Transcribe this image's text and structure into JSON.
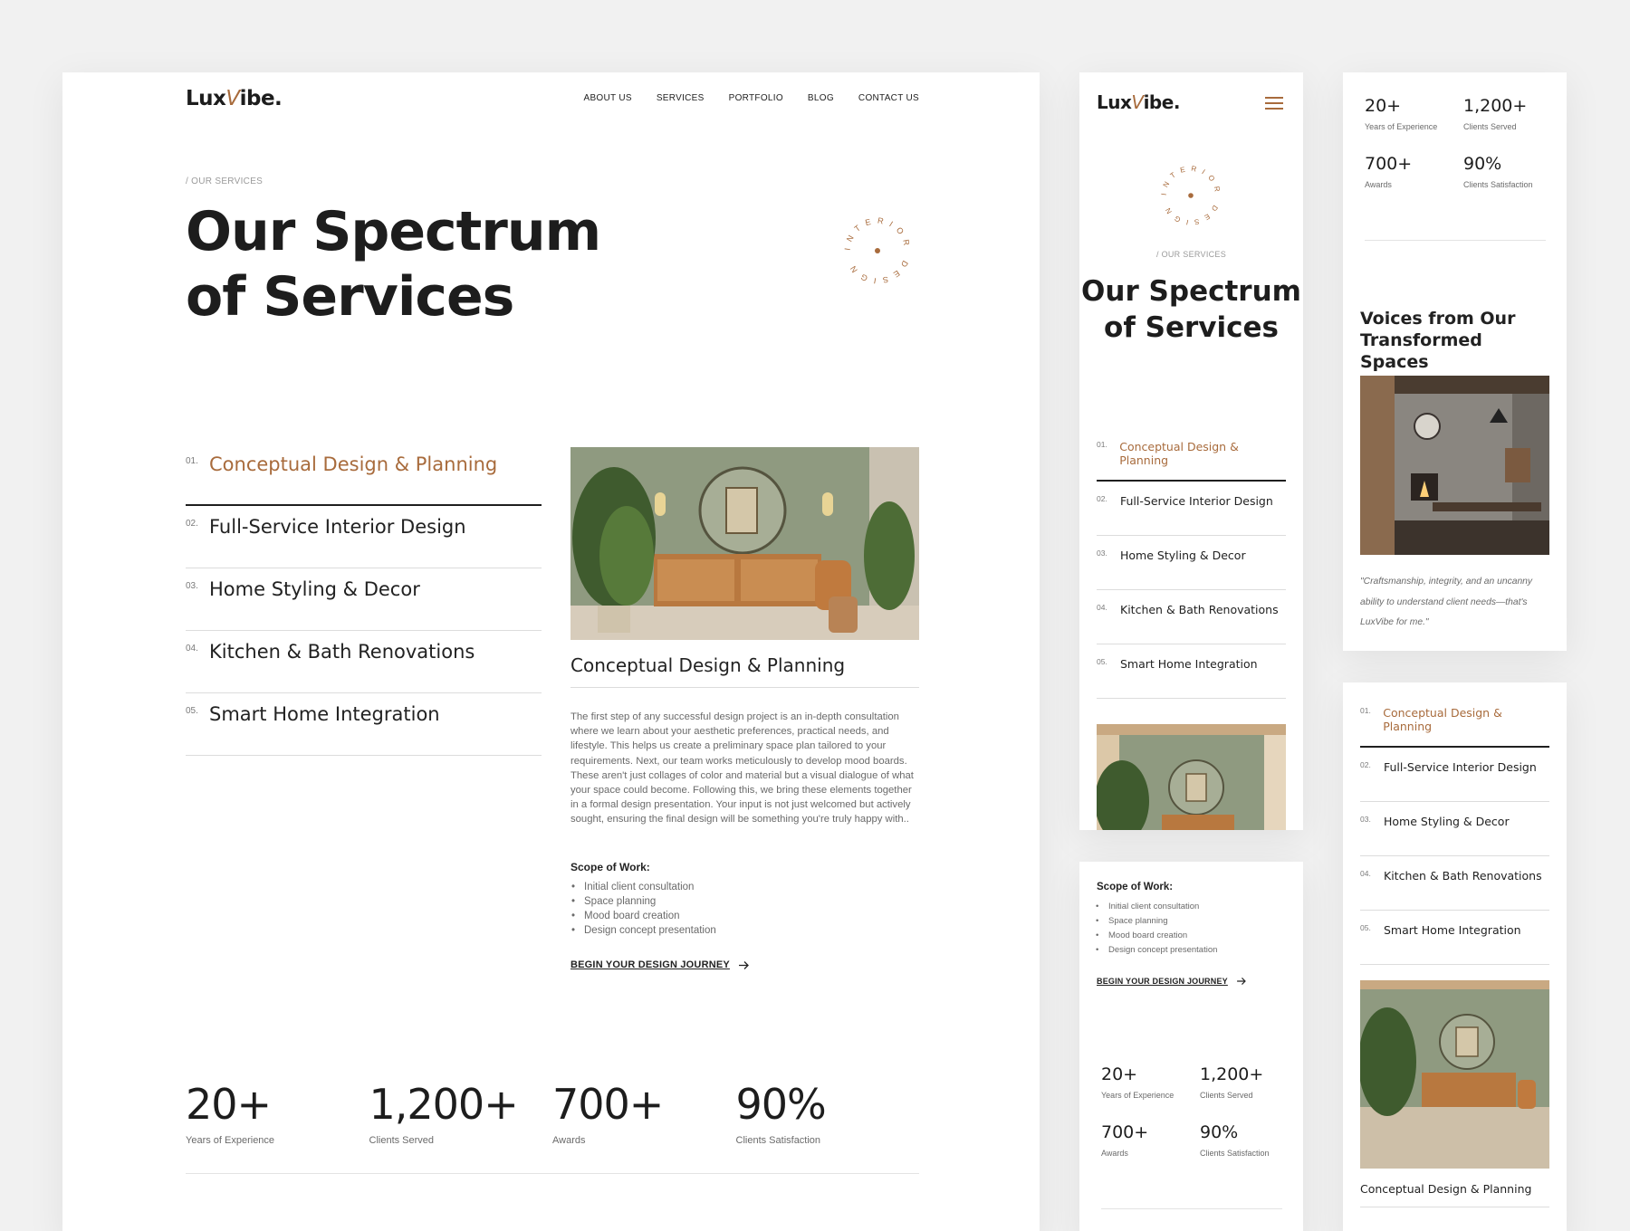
{
  "brand": {
    "logo_pre": "Lux",
    "logo_v": "V",
    "logo_post": "ibe."
  },
  "nav": [
    "ABOUT US",
    "SERVICES",
    "PORTFOLIO",
    "BLOG",
    "CONTACT US"
  ],
  "breadcrumb": "/ OUR SERVICES",
  "hero": {
    "title": "Our Spectrum of Services",
    "badge_text": "INTERIOR DESIGN"
  },
  "services": [
    {
      "num": "01.",
      "label": "Conceptual Design & Planning"
    },
    {
      "num": "02.",
      "label": "Full-Service Interior Design"
    },
    {
      "num": "03.",
      "label": "Home Styling & Decor"
    },
    {
      "num": "04.",
      "label": "Kitchen & Bath Renovations"
    },
    {
      "num": "05.",
      "label": "Smart Home Integration"
    }
  ],
  "detail": {
    "title": "Conceptual Design & Planning",
    "description": "The first step of any successful design project is an in-depth consultation where we learn about your aesthetic preferences, practical needs, and lifestyle. This helps us create a preliminary space plan tailored to your requirements. Next, our team works meticulously to develop mood boards. These aren't just collages of color and material but a visual dialogue of what your space could become. Following this, we bring these elements together in a formal design presentation. Your input is not just welcomed but actively sought, ensuring the final design will be something you're truly happy with..",
    "scope_heading": "Scope of Work:",
    "scope": [
      "Initial client consultation",
      "Space planning",
      "Mood board creation",
      "Design concept presentation"
    ],
    "cta": "BEGIN YOUR DESIGN JOURNEY"
  },
  "stats": [
    {
      "value": "20+",
      "label": "Years of Experience"
    },
    {
      "value": "1,200+",
      "label": "Clients Served"
    },
    {
      "value": "700+",
      "label": "Awards"
    },
    {
      "value": "90%",
      "label": "Clients Satisfaction"
    }
  ],
  "testimonials": {
    "heading": "Voices from Our Transformed Spaces",
    "quote": "\"Craftsmanship, integrity, and an uncanny ability to understand client needs—that's LuxVibe for me.\""
  },
  "colors": {
    "accent": "#a86b3c",
    "text": "#1d1d1d",
    "muted": "#6a6a6a",
    "background": "#f1f1f1"
  },
  "icons": {
    "menu": "hamburger-icon",
    "cta_arrow": "arrow-right-icon"
  }
}
